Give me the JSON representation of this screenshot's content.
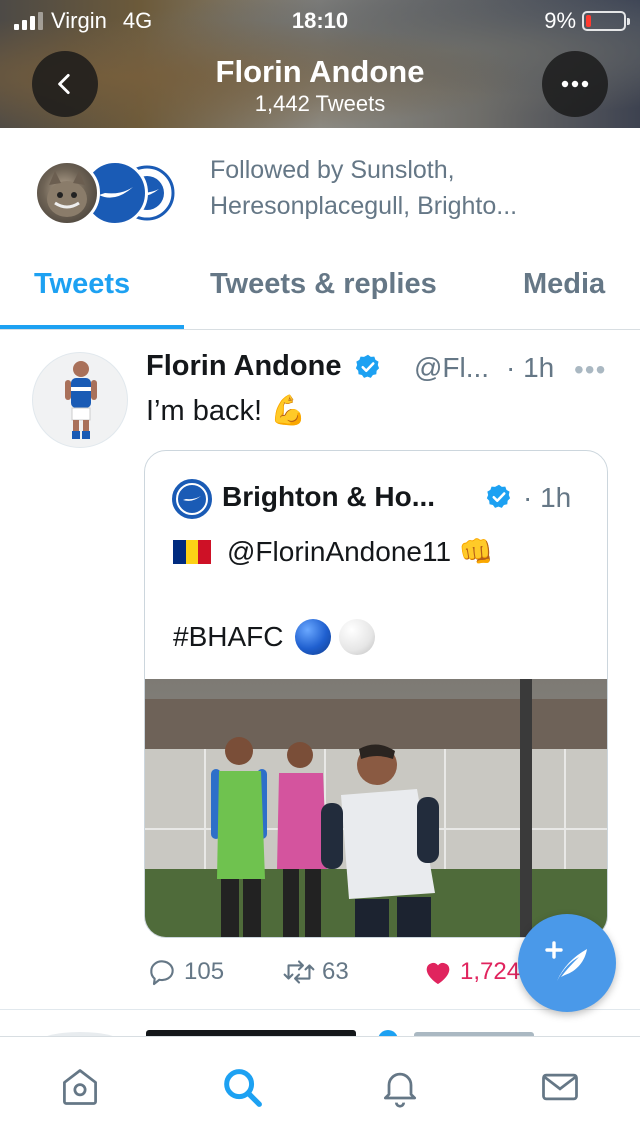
{
  "status_bar": {
    "carrier": "Virgin",
    "network": "4G",
    "time": "18:10",
    "battery": "9%",
    "battery_level": 0.09
  },
  "header": {
    "title": "Florin Andone",
    "subtitle": "1,442 Tweets"
  },
  "followed_by": {
    "text": "Followed by Sunsloth, Heresonplacegull, Brighto..."
  },
  "tabs": [
    {
      "label": "Tweets",
      "active": true
    },
    {
      "label": "Tweets & replies",
      "active": false
    },
    {
      "label": "Media",
      "active": false
    }
  ],
  "tweet": {
    "name": "Florin Andone",
    "handle": "@Fl...",
    "time": "· 1h",
    "text": "I’m back! 💪",
    "quoted": {
      "name": "Brighton & Ho...",
      "time": "· 1h",
      "mention": "@FlorinAndone11 👊",
      "hashtag": "#BHAFC"
    },
    "actions": {
      "replies": "105",
      "retweets": "63",
      "likes": "1,724"
    }
  },
  "colors": {
    "accent": "#1da1f2",
    "like": "#e0245e",
    "muted": "#657786",
    "fab": "#4a99e9"
  }
}
